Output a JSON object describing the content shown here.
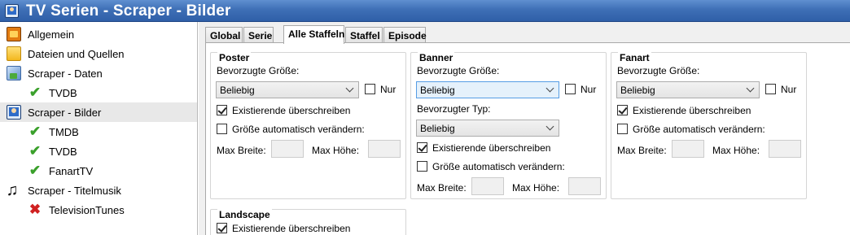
{
  "window": {
    "title": "TV Serien - Scraper - Bilder"
  },
  "sidebar": {
    "items": [
      {
        "label": "Allgemein",
        "icon": "tv-icon"
      },
      {
        "label": "Dateien und Quellen",
        "icon": "folder-icon"
      },
      {
        "label": "Scraper - Daten",
        "icon": "data-scraper-icon"
      },
      {
        "label": "TVDB",
        "icon": "check-icon"
      },
      {
        "label": "Scraper - Bilder",
        "icon": "picture-scraper-icon",
        "selected": true
      },
      {
        "label": "TMDB",
        "icon": "check-icon"
      },
      {
        "label": "TVDB",
        "icon": "check-icon"
      },
      {
        "label": "FanartTV",
        "icon": "check-icon"
      },
      {
        "label": "Scraper - Titelmusik",
        "icon": "music-note-icon"
      },
      {
        "label": "TelevisionTunes",
        "icon": "cross-icon"
      }
    ]
  },
  "tabs": [
    {
      "label": "Global"
    },
    {
      "label": "Serie"
    },
    {
      "label": "Alle Staffeln",
      "active": true
    },
    {
      "label": "Staffel"
    },
    {
      "label": "Episode"
    }
  ],
  "poster": {
    "title": "Poster",
    "size_label": "Bevorzugte Größe:",
    "size_value": "Beliebig",
    "only_label": "Nur",
    "only_checked": false,
    "overwrite_label": "Existierende überschreiben",
    "overwrite_checked": true,
    "resize_label": "Größe automatisch verändern:",
    "resize_checked": false,
    "max_width_label": "Max Breite:",
    "max_height_label": "Max Höhe:"
  },
  "banner": {
    "title": "Banner",
    "size_label": "Bevorzugte Größe:",
    "size_value": "Beliebig",
    "only_label": "Nur",
    "only_checked": false,
    "type_label": "Bevorzugter Typ:",
    "type_value": "Beliebig",
    "overwrite_label": "Existierende überschreiben",
    "overwrite_checked": true,
    "resize_label": "Größe automatisch verändern:",
    "resize_checked": false,
    "max_width_label": "Max Breite:",
    "max_height_label": "Max Höhe:"
  },
  "fanart": {
    "title": "Fanart",
    "size_label": "Bevorzugte Größe:",
    "size_value": "Beliebig",
    "only_label": "Nur",
    "only_checked": false,
    "overwrite_label": "Existierende überschreiben",
    "overwrite_checked": true,
    "resize_label": "Größe automatisch verändern:",
    "resize_checked": false,
    "max_width_label": "Max Breite:",
    "max_height_label": "Max Höhe:"
  },
  "landscape": {
    "title": "Landscape",
    "overwrite_label": "Existierende überschreiben",
    "overwrite_checked": true
  },
  "colors": {
    "titlebar": "#3e6fb6",
    "check": "#3aa02b",
    "cross": "#d02020"
  }
}
